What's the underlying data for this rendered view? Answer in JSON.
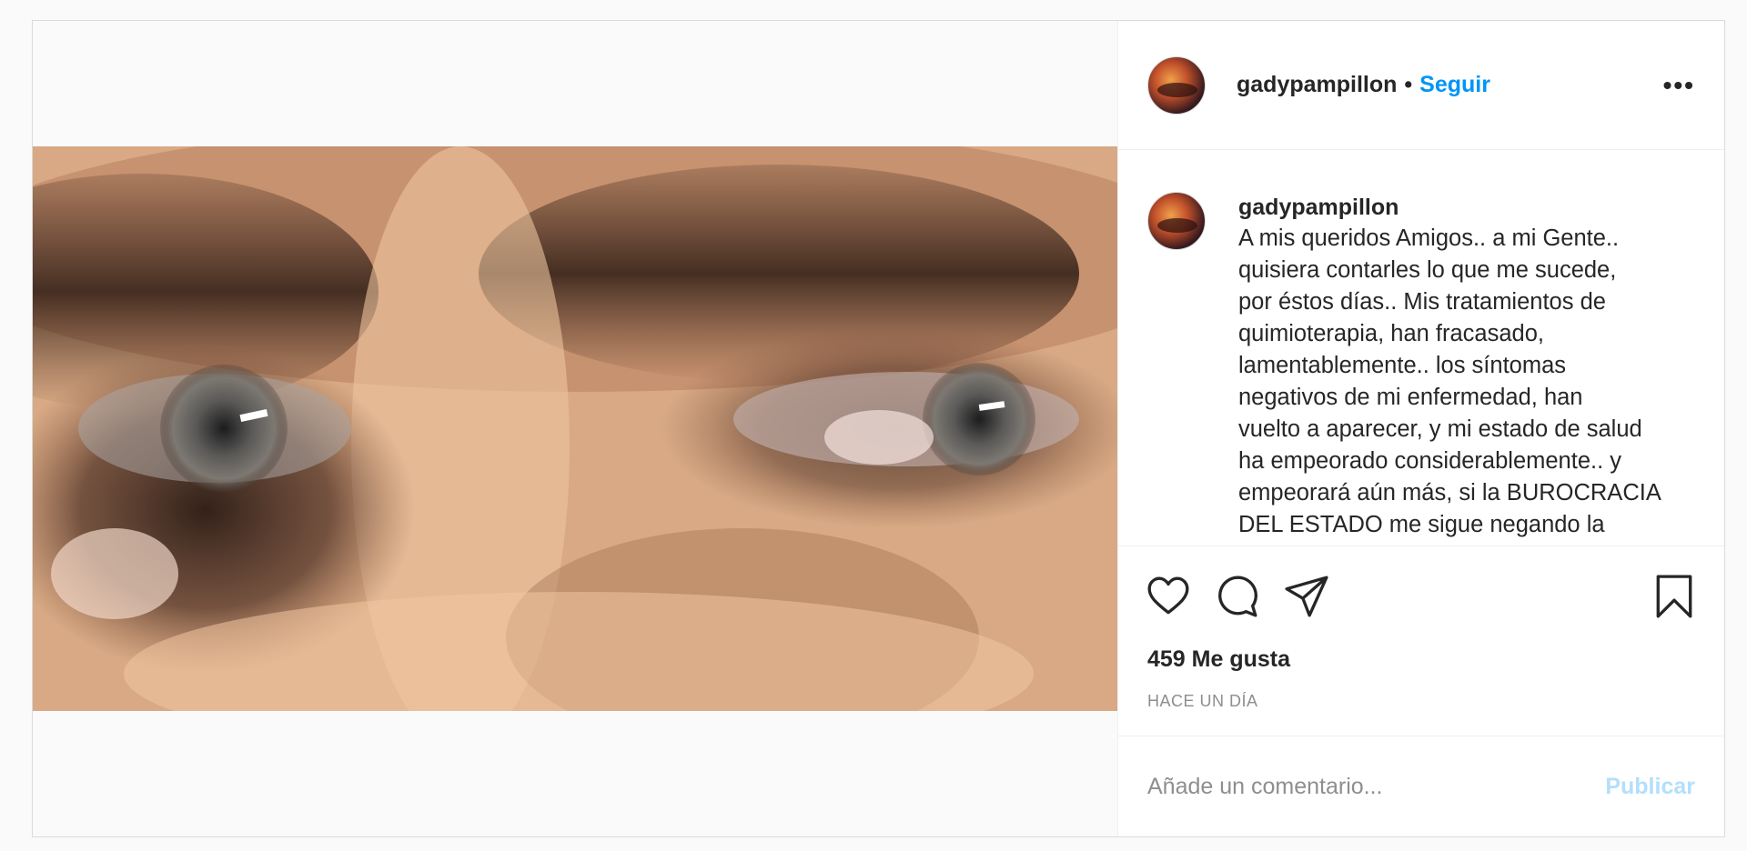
{
  "post": {
    "username": "gadypampillon",
    "separator": "•",
    "follow_label": "Seguir",
    "more_label": "•••",
    "caption_username": "gadypampillon",
    "caption_text": "A mis queridos Amigos.. a mi Gente..\nquisiera contarles lo que me sucede,\npor éstos días.. Mis tratamientos de\nquimioterapia, han fracasado,\nlamentablemente.. los síntomas\nnegativos de mi enfermedad, han\nvuelto a aparecer, y mi estado de salud\nha empeorado considerablemente.. y\nempeorará aún más, si la BUROCRACIA\nDEL ESTADO me sigue negando la\ndroga nueva, que estoy necesitando",
    "likes": "459 Me gusta",
    "timestamp": "HACE UN DÍA",
    "comment_placeholder": "Añade un comentario...",
    "publish_label": "Publicar"
  },
  "icons": {
    "like": "heart-icon",
    "comment": "comment-bubble-icon",
    "share": "paper-plane-icon",
    "save": "bookmark-icon",
    "more": "more-options-icon"
  },
  "colors": {
    "accent": "#0095f6",
    "publish_disabled": "#b2dffc",
    "secondary_text": "#8e8e8e",
    "border": "#dbdbdb"
  }
}
